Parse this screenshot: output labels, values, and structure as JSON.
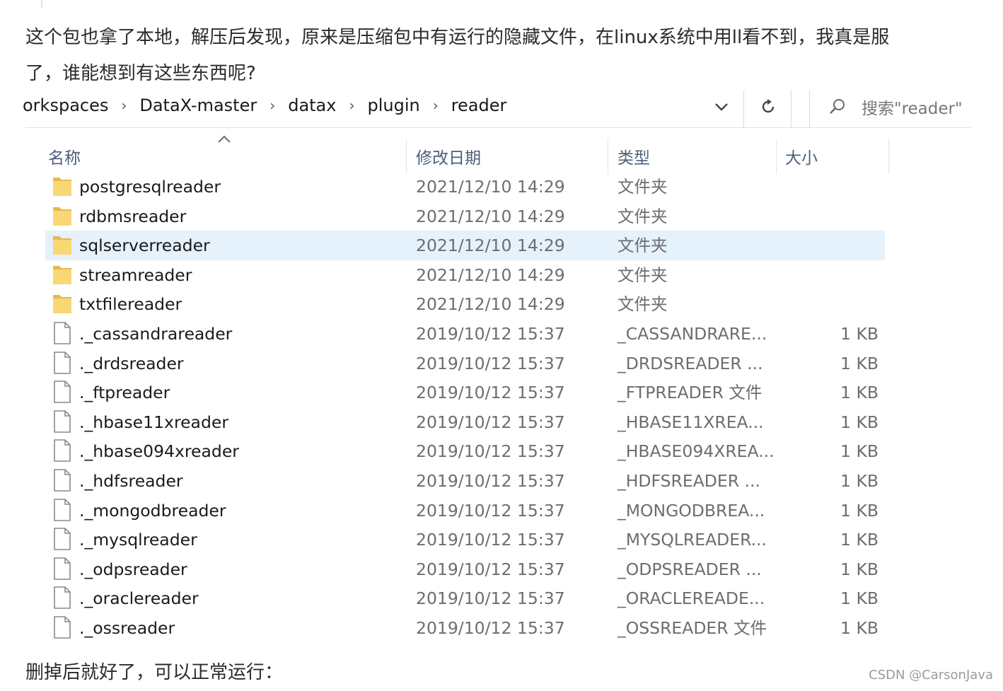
{
  "article": {
    "para1": "这个包也拿了本地，解压后发现，原来是压缩包中有运行的隐藏文件，在linux系统中用ll看不到，我真是服",
    "para2": "了，谁能想到有这些东西呢?",
    "para3": "删掉后就好了，可以正常运行："
  },
  "explorer": {
    "breadcrumb": [
      "orkspaces",
      "DataX-master",
      "datax",
      "plugin",
      "reader"
    ],
    "search_placeholder": "搜索\"reader\"",
    "columns": {
      "name": "名称",
      "date": "修改日期",
      "type": "类型",
      "size": "大小"
    },
    "rows": [
      {
        "name": "postgresqlreader",
        "date": "2021/12/10 14:29",
        "type": "文件夹",
        "size": "",
        "kind": "folder",
        "selected": false
      },
      {
        "name": "rdbmsreader",
        "date": "2021/12/10 14:29",
        "type": "文件夹",
        "size": "",
        "kind": "folder",
        "selected": false
      },
      {
        "name": "sqlserverreader",
        "date": "2021/12/10 14:29",
        "type": "文件夹",
        "size": "",
        "kind": "folder",
        "selected": true
      },
      {
        "name": "streamreader",
        "date": "2021/12/10 14:29",
        "type": "文件夹",
        "size": "",
        "kind": "folder",
        "selected": false
      },
      {
        "name": "txtfilereader",
        "date": "2021/12/10 14:29",
        "type": "文件夹",
        "size": "",
        "kind": "folder",
        "selected": false
      },
      {
        "name": "._cassandrareader",
        "date": "2019/10/12 15:37",
        "type": "_CASSANDRARE...",
        "size": "1 KB",
        "kind": "file",
        "selected": false
      },
      {
        "name": "._drdsreader",
        "date": "2019/10/12 15:37",
        "type": "_DRDSREADER ...",
        "size": "1 KB",
        "kind": "file",
        "selected": false
      },
      {
        "name": "._ftpreader",
        "date": "2019/10/12 15:37",
        "type": "_FTPREADER 文件",
        "size": "1 KB",
        "kind": "file",
        "selected": false
      },
      {
        "name": "._hbase11xreader",
        "date": "2019/10/12 15:37",
        "type": "_HBASE11XREA...",
        "size": "1 KB",
        "kind": "file",
        "selected": false
      },
      {
        "name": "._hbase094xreader",
        "date": "2019/10/12 15:37",
        "type": "_HBASE094XREA...",
        "size": "1 KB",
        "kind": "file",
        "selected": false
      },
      {
        "name": "._hdfsreader",
        "date": "2019/10/12 15:37",
        "type": "_HDFSREADER ...",
        "size": "1 KB",
        "kind": "file",
        "selected": false
      },
      {
        "name": "._mongodbreader",
        "date": "2019/10/12 15:37",
        "type": "_MONGODBREA...",
        "size": "1 KB",
        "kind": "file",
        "selected": false
      },
      {
        "name": "._mysqlreader",
        "date": "2019/10/12 15:37",
        "type": "_MYSQLREADER...",
        "size": "1 KB",
        "kind": "file",
        "selected": false
      },
      {
        "name": "._odpsreader",
        "date": "2019/10/12 15:37",
        "type": "_ODPSREADER ...",
        "size": "1 KB",
        "kind": "file",
        "selected": false
      },
      {
        "name": "._oraclereader",
        "date": "2019/10/12 15:37",
        "type": "_ORACLEREADE...",
        "size": "1 KB",
        "kind": "file",
        "selected": false
      },
      {
        "name": "._ossreader",
        "date": "2019/10/12 15:37",
        "type": "_OSSREADER 文件",
        "size": "1 KB",
        "kind": "file",
        "selected": false
      }
    ]
  },
  "watermark": "CSDN @CarsonJava",
  "colors": {
    "selected_row": "#e5f1fb",
    "folder_yellow": "#f8d775",
    "header_text": "#4c607a"
  },
  "icons": {
    "folder": "folder-icon",
    "file": "file-icon",
    "search": "search-icon",
    "refresh": "refresh-icon",
    "dropdown": "chevron-down-icon",
    "breadcrumb_separator": "chevron-right-icon",
    "sort": "sort-ascending-icon"
  }
}
